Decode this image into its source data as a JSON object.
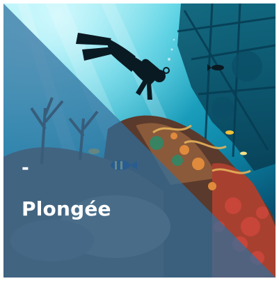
{
  "tile": {
    "prefix": "-",
    "title": "Plongée"
  },
  "colors": {
    "water_light": "#7fe3f0",
    "water_mid": "#1fb6d3",
    "water_deep": "#0b6f93",
    "overlay_blue": "#2f6f9e",
    "coral_red": "#c8453a",
    "coral_orange": "#e08a3c",
    "text": "#ffffff"
  },
  "icons": {
    "diver": "scuba-diver-silhouette",
    "fish": "fish-silhouette"
  }
}
